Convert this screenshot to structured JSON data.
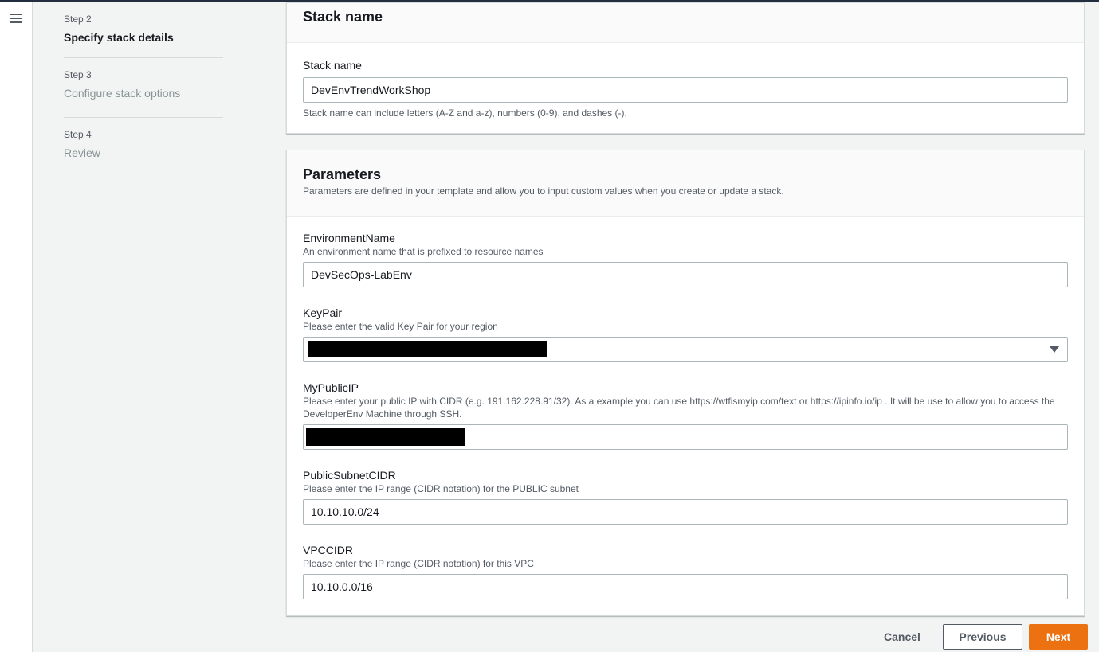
{
  "nav": {
    "menu_icon": "hamburger-menu-icon"
  },
  "steps": [
    {
      "number": "Step 2",
      "title": "Specify stack details",
      "active": true
    },
    {
      "number": "Step 3",
      "title": "Configure stack options",
      "active": false
    },
    {
      "number": "Step 4",
      "title": "Review",
      "active": false
    }
  ],
  "stack_name_panel": {
    "title": "Stack name",
    "field_label": "Stack name",
    "value": "DevEnvTrendWorkShop",
    "hint": "Stack name can include letters (A-Z and a-z), numbers (0-9), and dashes (-)."
  },
  "parameters_panel": {
    "title": "Parameters",
    "description": "Parameters are defined in your template and allow you to input custom values when you create or update a stack.",
    "fields": [
      {
        "label": "EnvironmentName",
        "description": "An environment name that is prefixed to resource names",
        "value": "DevSecOps-LabEnv"
      },
      {
        "label": "KeyPair",
        "description": "Please enter the valid Key Pair for your region",
        "value": "",
        "redacted": true,
        "type": "select"
      },
      {
        "label": "MyPublicIP",
        "description": "Please enter your public IP with CIDR (e.g. 191.162.228.91/32). As a example you can use https://wtfismyip.com/text or https://ipinfo.io/ip . It will be use to allow you to access the DeveloperEnv Machine through SSH.",
        "value": "",
        "redacted": true
      },
      {
        "label": "PublicSubnetCIDR",
        "description": "Please enter the IP range (CIDR notation) for the PUBLIC subnet",
        "value": "10.10.10.0/24"
      },
      {
        "label": "VPCCIDR",
        "description": "Please enter the IP range (CIDR notation) for this VPC",
        "value": "10.10.0.0/16"
      }
    ]
  },
  "footer": {
    "cancel_label": "Cancel",
    "previous_label": "Previous",
    "next_label": "Next"
  },
  "colors": {
    "primary_button": "#ec7211",
    "header_bar": "#232f3e",
    "page_background": "#f2f3f3"
  }
}
